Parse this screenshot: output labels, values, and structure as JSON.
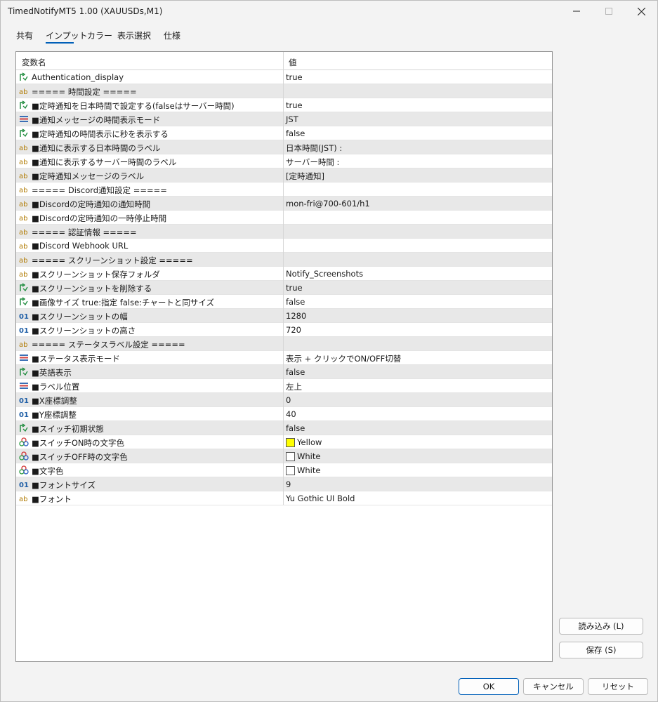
{
  "window": {
    "title": "TimedNotifyMT5 1.00 (XAUUSDs,M1)"
  },
  "tabs": [
    "共有",
    "インプット",
    "カラー",
    "表示選択",
    "仕様"
  ],
  "grid": {
    "header": {
      "name": "変数名",
      "value": "値"
    },
    "rows": [
      {
        "icon": "bool",
        "name": "Authentication_display",
        "value": "true"
      },
      {
        "icon": "string",
        "name": "===== 時間設定 =====",
        "value": ""
      },
      {
        "icon": "bool",
        "name": "■定時通知を日本時間で設定する(falseはサーバー時間)",
        "value": "true"
      },
      {
        "icon": "enum",
        "name": "■通知メッセージの時間表示モード",
        "value": "JST"
      },
      {
        "icon": "bool",
        "name": "■定時通知の時間表示に秒を表示する",
        "value": "false"
      },
      {
        "icon": "string",
        "name": "■通知に表示する日本時間のラベル",
        "value": "日本時間(JST) :"
      },
      {
        "icon": "string",
        "name": "■通知に表示するサーバー時間のラベル",
        "value": "サーバー時間 :"
      },
      {
        "icon": "string",
        "name": "■定時通知メッセージのラベル",
        "value": "[定時通知]"
      },
      {
        "icon": "string",
        "name": "===== Discord通知設定 =====",
        "value": ""
      },
      {
        "icon": "string",
        "name": "■Discordの定時通知の通知時間",
        "value": "mon-fri@700-601/h1"
      },
      {
        "icon": "string",
        "name": "■Discordの定時通知の一時停止時間",
        "value": ""
      },
      {
        "icon": "string",
        "name": "===== 認証情報 =====",
        "value": ""
      },
      {
        "icon": "string",
        "name": "■Discord Webhook URL",
        "value": ""
      },
      {
        "icon": "string",
        "name": "===== スクリーンショット設定 =====",
        "value": ""
      },
      {
        "icon": "string",
        "name": "■スクリーンショット保存フォルダ",
        "value": "Notify_Screenshots"
      },
      {
        "icon": "bool",
        "name": "■スクリーンショットを削除する",
        "value": "true"
      },
      {
        "icon": "bool",
        "name": "■画像サイズ true:指定 false:チャートと同サイズ",
        "value": "false"
      },
      {
        "icon": "int",
        "name": "■スクリーンショットの幅",
        "value": "1280"
      },
      {
        "icon": "int",
        "name": "■スクリーンショットの高さ",
        "value": "720"
      },
      {
        "icon": "string",
        "name": "===== ステータスラベル設定 =====",
        "value": ""
      },
      {
        "icon": "enum",
        "name": "■ステータス表示モード",
        "value": "表示 + クリックでON/OFF切替"
      },
      {
        "icon": "bool",
        "name": "■英語表示",
        "value": "false"
      },
      {
        "icon": "enum",
        "name": "■ラベル位置",
        "value": "左上"
      },
      {
        "icon": "int",
        "name": "■X座標調整",
        "value": "0"
      },
      {
        "icon": "int",
        "name": "■Y座標調整",
        "value": "40"
      },
      {
        "icon": "bool",
        "name": "■スイッチ初期状態",
        "value": "false"
      },
      {
        "icon": "color",
        "name": "■スイッチON時の文字色",
        "value": "Yellow",
        "swatch": "#ffff00"
      },
      {
        "icon": "color",
        "name": "■スイッチOFF時の文字色",
        "value": "White",
        "swatch": "#ffffff"
      },
      {
        "icon": "color",
        "name": "■文字色",
        "value": "White",
        "swatch": "#ffffff"
      },
      {
        "icon": "int",
        "name": "■フォントサイズ",
        "value": "9"
      },
      {
        "icon": "string",
        "name": "■フォント",
        "value": "Yu Gothic UI Bold"
      }
    ]
  },
  "buttons": {
    "load": "読み込み (L)",
    "save": "保存 (S)",
    "ok": "OK",
    "cancel": "キャンセル",
    "reset": "リセット"
  }
}
